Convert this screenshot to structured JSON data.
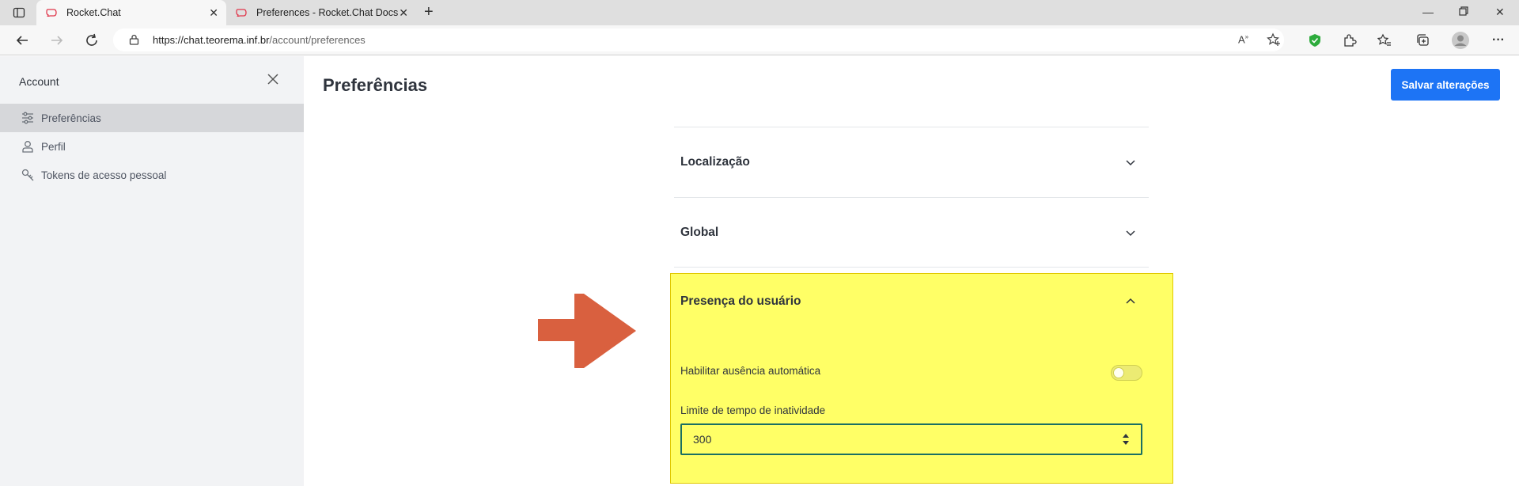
{
  "browser": {
    "tabs": [
      {
        "label": "Rocket.Chat",
        "active": true
      },
      {
        "label": "Preferences - Rocket.Chat Docs",
        "active": false
      }
    ],
    "url_host": "https://chat.teorema.inf.br",
    "url_path": "/account/preferences"
  },
  "sidebar": {
    "title": "Account",
    "items": [
      {
        "label": "Preferências",
        "icon": "sliders-icon",
        "active": true
      },
      {
        "label": "Perfil",
        "icon": "user-icon",
        "active": false
      },
      {
        "label": "Tokens de acesso pessoal",
        "icon": "key-icon",
        "active": false
      }
    ]
  },
  "main": {
    "title": "Preferências",
    "save_label": "Salvar alterações",
    "sections": [
      {
        "label": "Localização",
        "expanded": false
      },
      {
        "label": "Global",
        "expanded": false
      },
      {
        "label": "Presença do usuário",
        "expanded": true
      }
    ],
    "presence": {
      "auto_away_label": "Habilitar ausência automática",
      "auto_away_enabled": false,
      "idle_limit_label": "Limite de tempo de inatividade",
      "idle_limit_value": "300"
    }
  },
  "colors": {
    "accent": "#1d74f5",
    "highlight": "#ffff66",
    "arrow": "#d9603f"
  }
}
